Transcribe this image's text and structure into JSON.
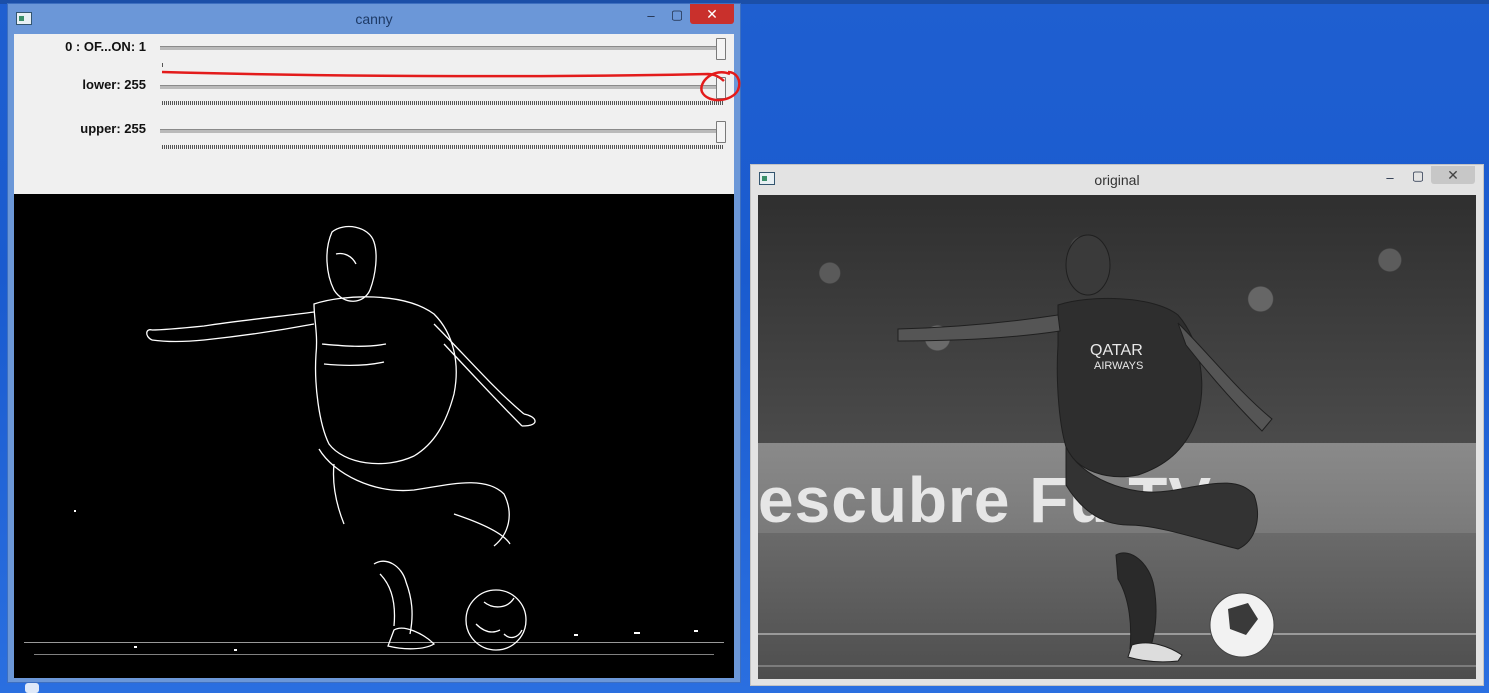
{
  "canny_window": {
    "title": "canny",
    "controls": {
      "minimize": "–",
      "maximize": "▢",
      "close": "✕"
    },
    "trackbars": [
      {
        "label": "0 : OF...ON: 1",
        "value": 1,
        "max": 1
      },
      {
        "label": "lower: 255",
        "value": 255,
        "max": 255
      },
      {
        "label": "upper: 255",
        "value": 255,
        "max": 255
      }
    ],
    "annotation_color": "#e31b1b"
  },
  "original_window": {
    "title": "original",
    "controls": {
      "minimize": "–",
      "maximize": "▢",
      "close": "✕"
    },
    "banner_text": "escubre Fu        TV",
    "jersey_text": [
      "QATAR",
      "AIRWAYS"
    ]
  }
}
